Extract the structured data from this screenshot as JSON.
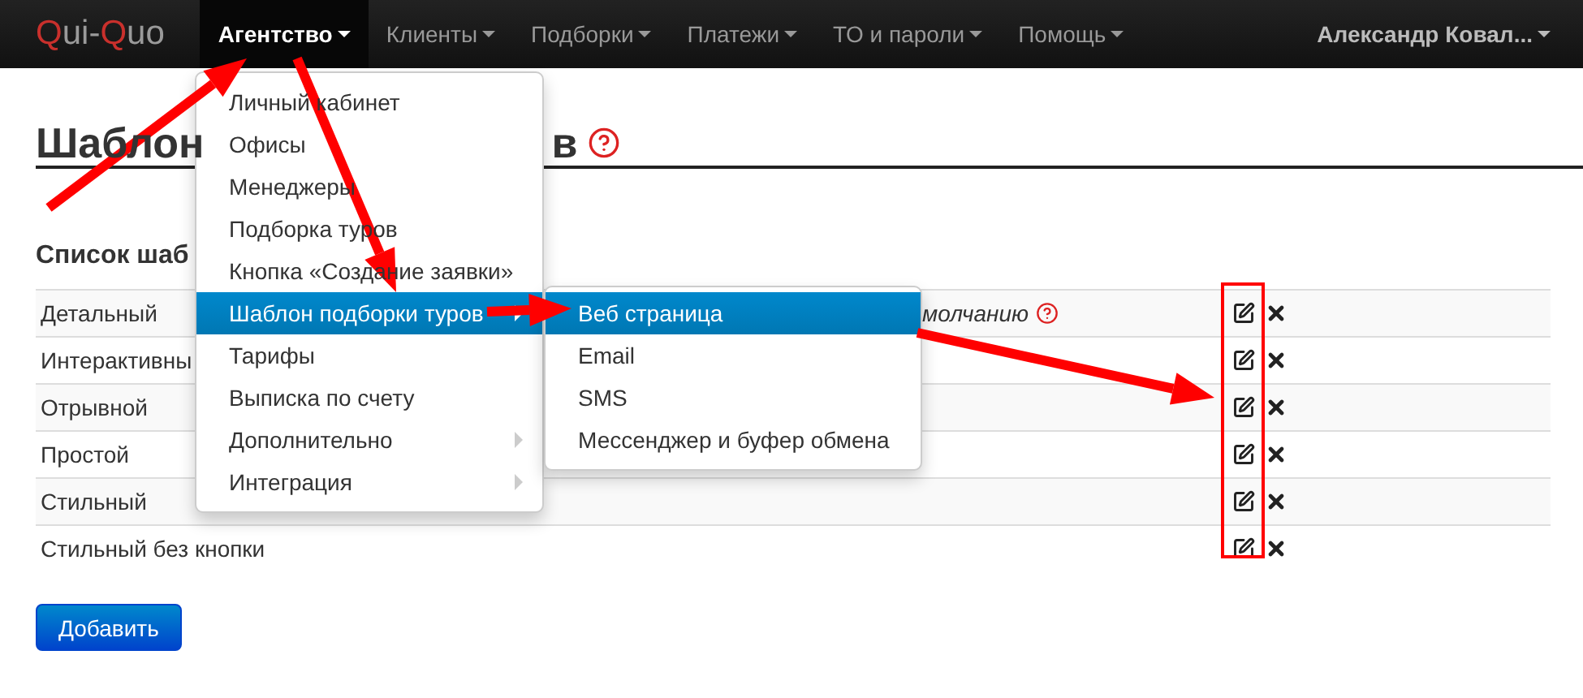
{
  "navbar": {
    "logo": [
      {
        "text": "Q",
        "accent": true
      },
      {
        "text": "ui-",
        "accent": false
      },
      {
        "text": "Q",
        "accent": true
      },
      {
        "text": "uo",
        "accent": false
      }
    ],
    "items": [
      {
        "label": "Агентство",
        "selected": true
      },
      {
        "label": "Клиенты",
        "selected": false
      },
      {
        "label": "Подборки",
        "selected": false
      },
      {
        "label": "Платежи",
        "selected": false
      },
      {
        "label": "ТО и пароли",
        "selected": false
      },
      {
        "label": "Помощь",
        "selected": false
      }
    ],
    "user": "Александр Ковал..."
  },
  "page": {
    "heading_parts": [
      "Шаблон",
      "в"
    ],
    "subheading": "Список шаб",
    "rows": [
      {
        "name": "Детальный",
        "note": "молчанию"
      },
      {
        "name": "Интерактивны"
      },
      {
        "name": "Отрывной"
      },
      {
        "name": "Простой"
      },
      {
        "name": "Стильный"
      },
      {
        "name": "Стильный без кнопки"
      }
    ],
    "add_button": "Добавить"
  },
  "dropdown": {
    "items": [
      {
        "label": "Личный кабинет",
        "selected": false,
        "has_submenu": false
      },
      {
        "label": "Офисы",
        "selected": false,
        "has_submenu": false
      },
      {
        "label": "Менеджеры",
        "selected": false,
        "has_submenu": false
      },
      {
        "label": "Подборка туров",
        "selected": false,
        "has_submenu": false
      },
      {
        "label": "Кнопка «Создание заявки»",
        "selected": false,
        "has_submenu": false
      },
      {
        "label": "Шаблон подборки туров",
        "selected": true,
        "has_submenu": true
      },
      {
        "label": "Тарифы",
        "selected": false,
        "has_submenu": false
      },
      {
        "label": "Выписка по счету",
        "selected": false,
        "has_submenu": false
      },
      {
        "label": "Дополнительно",
        "selected": false,
        "has_submenu": true
      },
      {
        "label": "Интеграция",
        "selected": false,
        "has_submenu": true
      }
    ],
    "submenu": [
      {
        "label": "Веб страница",
        "selected": true
      },
      {
        "label": "Email",
        "selected": false
      },
      {
        "label": "SMS",
        "selected": false
      },
      {
        "label": "Мессенджер и буфер обмена",
        "selected": false
      }
    ]
  }
}
